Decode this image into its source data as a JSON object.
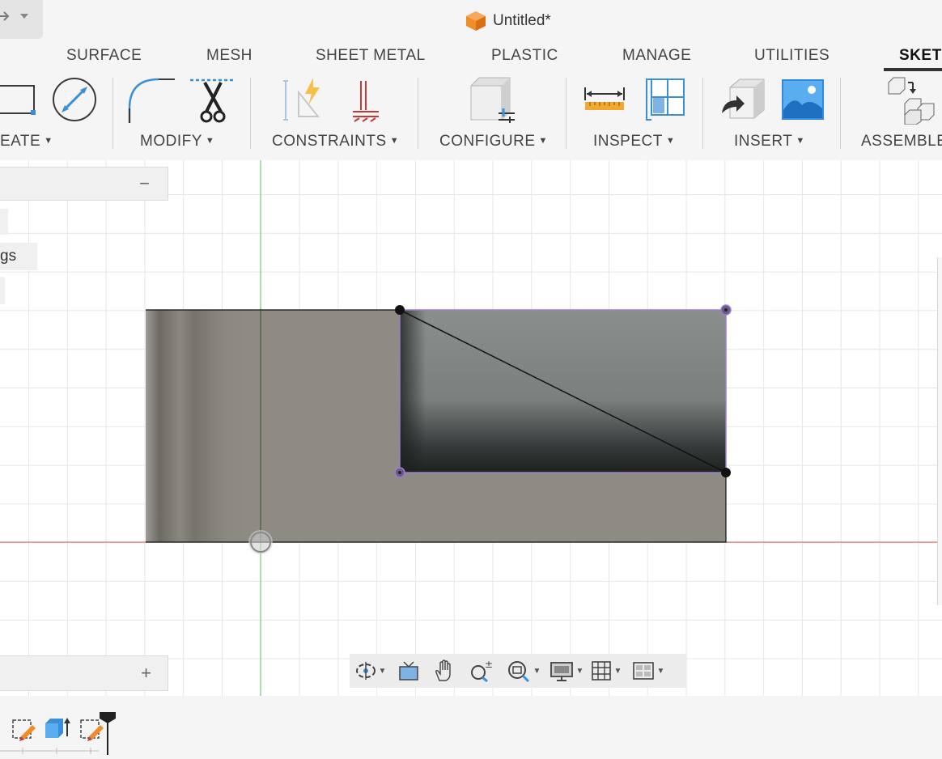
{
  "app": {
    "document_title": "Untitled*",
    "title_icon": "fusion-cube-icon"
  },
  "tabs": [
    {
      "label": "SURFACE",
      "active": false
    },
    {
      "label": "MESH",
      "active": false
    },
    {
      "label": "SHEET METAL",
      "active": false
    },
    {
      "label": "PLASTIC",
      "active": false
    },
    {
      "label": "MANAGE",
      "active": false
    },
    {
      "label": "UTILITIES",
      "active": false
    },
    {
      "label": "SKETC",
      "active": true
    }
  ],
  "toolbar": {
    "groups": [
      {
        "label": "EATE",
        "tools": [
          "rectangle-icon",
          "circle-diameter-icon"
        ]
      },
      {
        "label": "MODIFY",
        "tools": [
          "fillet-icon",
          "trim-scissors-icon"
        ]
      },
      {
        "label": "CONSTRAINTS",
        "tools": [
          "auto-constrain-icon",
          "perpendicular-constraint-icon"
        ]
      },
      {
        "label": "CONFIGURE",
        "tools": [
          "configure-cube-icon"
        ]
      },
      {
        "label": "INSPECT",
        "tools": [
          "measure-ruler-icon",
          "interference-grid-icon"
        ]
      },
      {
        "label": "INSERT",
        "tools": [
          "insert-derive-icon",
          "insert-image-icon"
        ]
      },
      {
        "label": "ASSEMBLE",
        "tools": [
          "assemble-components-icon"
        ]
      }
    ]
  },
  "browser_panel": {
    "row_text": "gs",
    "collapse_symbol": "−",
    "expand_symbol": "+"
  },
  "navigation_bar": {
    "tools": [
      "orbit-icon",
      "look-at-icon",
      "pan-hand-icon",
      "zoom-window-icon",
      "fit-zoom-icon",
      "display-settings-icon",
      "grid-settings-icon",
      "viewports-icon"
    ]
  },
  "timeline": {
    "items": [
      "sketch-edit-icon",
      "extrude-body-icon",
      "sketch-edit-icon"
    ]
  },
  "colors": {
    "accent_orange": "#f08c2a",
    "selection_purple": "#9a7fd0",
    "x_axis_red": "#e05050",
    "y_axis_green": "#5cc45c",
    "body_gray": "#8e8b84",
    "pocket_gray": "#858a88",
    "ui_blue": "#3b8fd6"
  }
}
